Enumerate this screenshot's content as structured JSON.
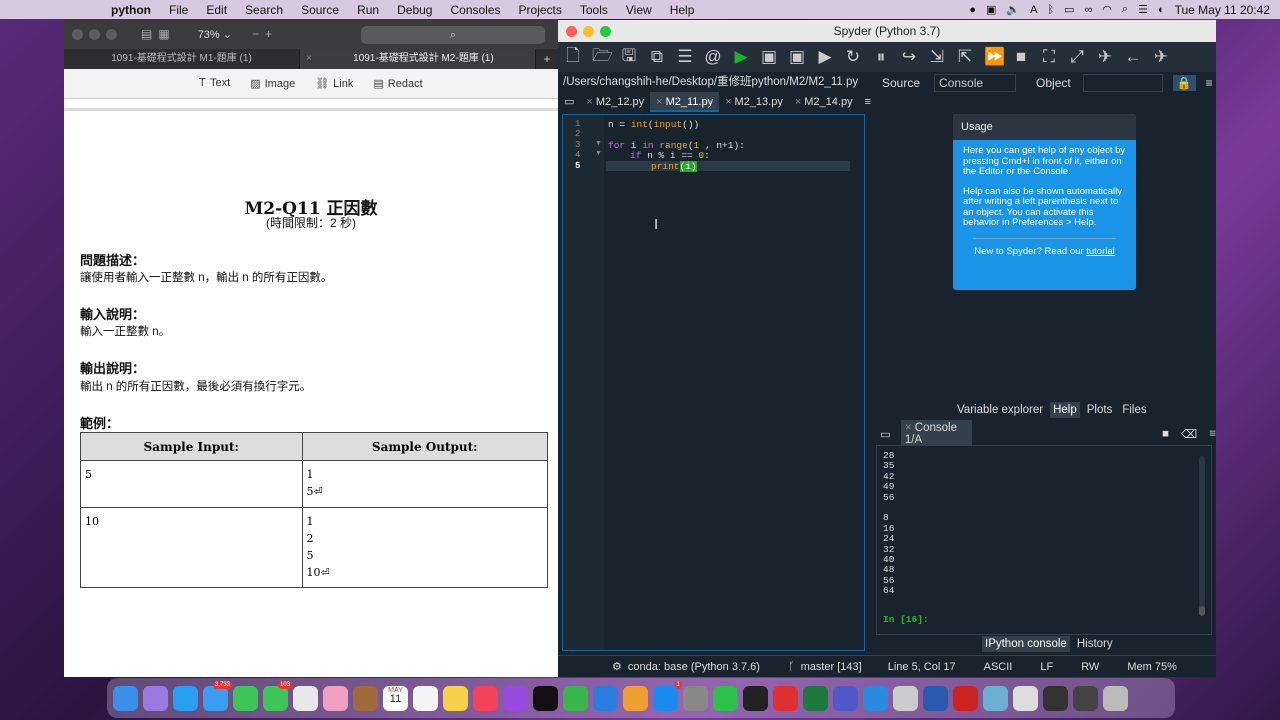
{
  "menubar": {
    "app": "python",
    "items": [
      "File",
      "Edit",
      "Search",
      "Source",
      "Run",
      "Debug",
      "Consoles",
      "Projects",
      "Tools",
      "View",
      "Help"
    ],
    "clock": "Tue May 11  20:42"
  },
  "pdf": {
    "zoom": "73%",
    "tabs": [
      "1091-基礎程式設計 M1-題庫 (1)",
      "1091-基礎程式設計 M2-題庫 (1)"
    ],
    "tools": [
      "Text",
      "Image",
      "Link",
      "Redact"
    ],
    "title": "M2-Q11 正因數",
    "limit": "(時間限制：2 秒)",
    "sections": [
      {
        "heading": "問題描述：",
        "text": "讓使用者輸入一正整數 n，輸出 n 的所有正因數。"
      },
      {
        "heading": "輸入說明：",
        "text": "輸入一正整數 n。"
      },
      {
        "heading": "輸出說明：",
        "text": "輸出 n 的所有正因數，最後必須有換行字元。"
      }
    ],
    "sample_heading": "範例：",
    "table_headers": [
      "Sample Input:",
      "Sample Output:"
    ],
    "rows": [
      {
        "input": "5",
        "output": [
          "1",
          "5⏎"
        ]
      },
      {
        "input": "10",
        "output": [
          "1",
          "2",
          "5",
          "10⏎"
        ]
      }
    ]
  },
  "spyder": {
    "title": "Spyder (Python 3.7)",
    "path": "/Users/changshih-he/Desktop/重修班python/M2/M2_11.py",
    "tabs": [
      "M2_12.py",
      "M2_11.py",
      "M2_13.py",
      "M2_14.py"
    ],
    "active_tab": "M2_11.py",
    "code": {
      "line_numbers": [
        "1",
        "2",
        "3",
        "4",
        "5"
      ],
      "l1_var": "n",
      "l1_eq": " = ",
      "l1_int": "int",
      "l1_paren1": "(",
      "l1_input": "input",
      "l1_paren2": "())",
      "l3_for": "for",
      "l3_i": " i ",
      "l3_in": "in",
      "l3_range": " range",
      "l3_open": "(",
      "l3_one": "1",
      "l3_rest": " , n+1):",
      "l4_if": "if",
      "l4_mid": " n % i == ",
      "l4_zero": "0",
      "l4_colon": ":",
      "l5_print": "print",
      "l5_arg": "(i)"
    },
    "help": {
      "source_label": "Source",
      "source_value": "Console",
      "object_label": "Object",
      "usage_title": "Usage",
      "p1": "Here you can get help of any object by pressing Cmd+I in front of it, either on the Editor or the Console.",
      "p2": "Help can also be shown automatically after writing a left parenthesis next to an object. You can activate this behavior in Preferences > Help.",
      "footer_text": "New to Spyder? Read our",
      "footer_link": "tutorial"
    },
    "pane_tabs": [
      "Variable explorer",
      "Help",
      "Plots",
      "Files"
    ],
    "console_tab": "Console 1/A",
    "console_output": [
      "28",
      "35",
      "42",
      "49",
      "56",
      "",
      "8",
      "16",
      "24",
      "32",
      "40",
      "48",
      "56",
      "64"
    ],
    "prompt": "In [16]:",
    "console_tabs": [
      "IPython console",
      "History"
    ],
    "status": {
      "conda": "conda: base (Python 3.7.6)",
      "git": "master [143]",
      "pos": "Line 5, Col 17",
      "enc": "ASCII",
      "eol": "LF",
      "rw": "RW",
      "mem": "Mem 75%"
    }
  },
  "dock": {
    "badges": {
      "mail": "3,733",
      "messages": "103",
      "appstore": "1"
    },
    "calendar_month": "MAY",
    "calendar_day": "11"
  }
}
